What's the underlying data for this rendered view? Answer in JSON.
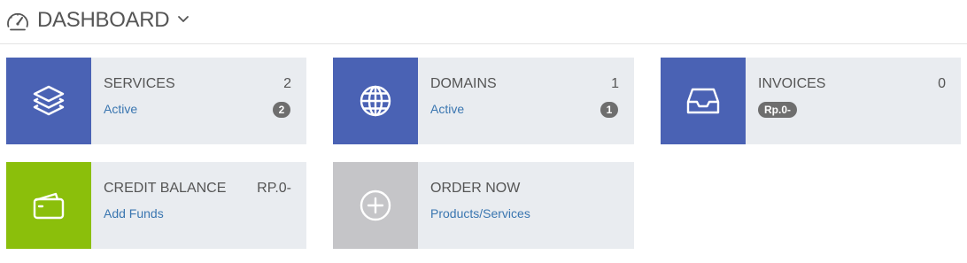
{
  "header": {
    "title": "DASHBOARD",
    "icon": "speedometer-icon",
    "dropdown_icon": "chevron-down-icon"
  },
  "tiles": [
    {
      "title": "SERVICES",
      "stat": "2",
      "link": "Active",
      "badge": "2",
      "icon": "layers-icon",
      "color": "#4a62b4"
    },
    {
      "title": "DOMAINS",
      "stat": "1",
      "link": "Active",
      "badge": "1",
      "icon": "globe-icon",
      "color": "#4a62b4"
    },
    {
      "title": "INVOICES",
      "stat": "0",
      "badge": "Rp.0-",
      "icon": "inbox-tray-icon",
      "color": "#4a62b4"
    },
    {
      "title": "CREDIT BALANCE",
      "stat": "RP.0-",
      "link": "Add Funds",
      "icon": "wallet-icon",
      "color": "#8bbf0b"
    },
    {
      "title": "ORDER NOW",
      "link": "Products/Services",
      "icon": "plus-circle-icon",
      "color": "#c5c5c8"
    }
  ],
  "colors": {
    "tile_background": "#e9ecf0",
    "link": "#3a76b0",
    "badge": "#6e6e6e"
  }
}
